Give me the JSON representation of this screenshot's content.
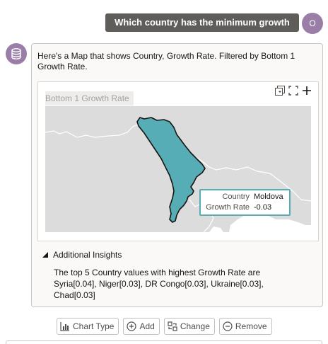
{
  "user": {
    "message": "Which country has the minimum growth rate",
    "avatar_initial": "O"
  },
  "bot": {
    "response_text": "Here's a Map that shows Country, Growth Rate. Filtered by Bottom 1 Growth Rate.",
    "map": {
      "title": "Bottom 1 Growth Rate",
      "highlight_color": "#56adb5",
      "tooltip": {
        "country_label": "Country",
        "country_value": "Moldova",
        "growth_label": "Growth Rate",
        "growth_value": "-0.03"
      }
    },
    "insights": {
      "heading": "Additional Insights",
      "text": "The top 5 Country values with highest Growth Rate are Syria[0.04], Niger[0.03], DR Congo[0.03], Ukraine[0.03], Chad[0.03]"
    }
  },
  "actions": {
    "chart_type": "Chart Type",
    "add": "Add",
    "change": "Change",
    "remove": "Remove"
  },
  "icons": {
    "bot_avatar": "database-icon",
    "map_tools": [
      "expand-collapse-icon",
      "fullscreen-icon",
      "plus-icon"
    ],
    "insights_toggle": "caret-down-icon"
  }
}
